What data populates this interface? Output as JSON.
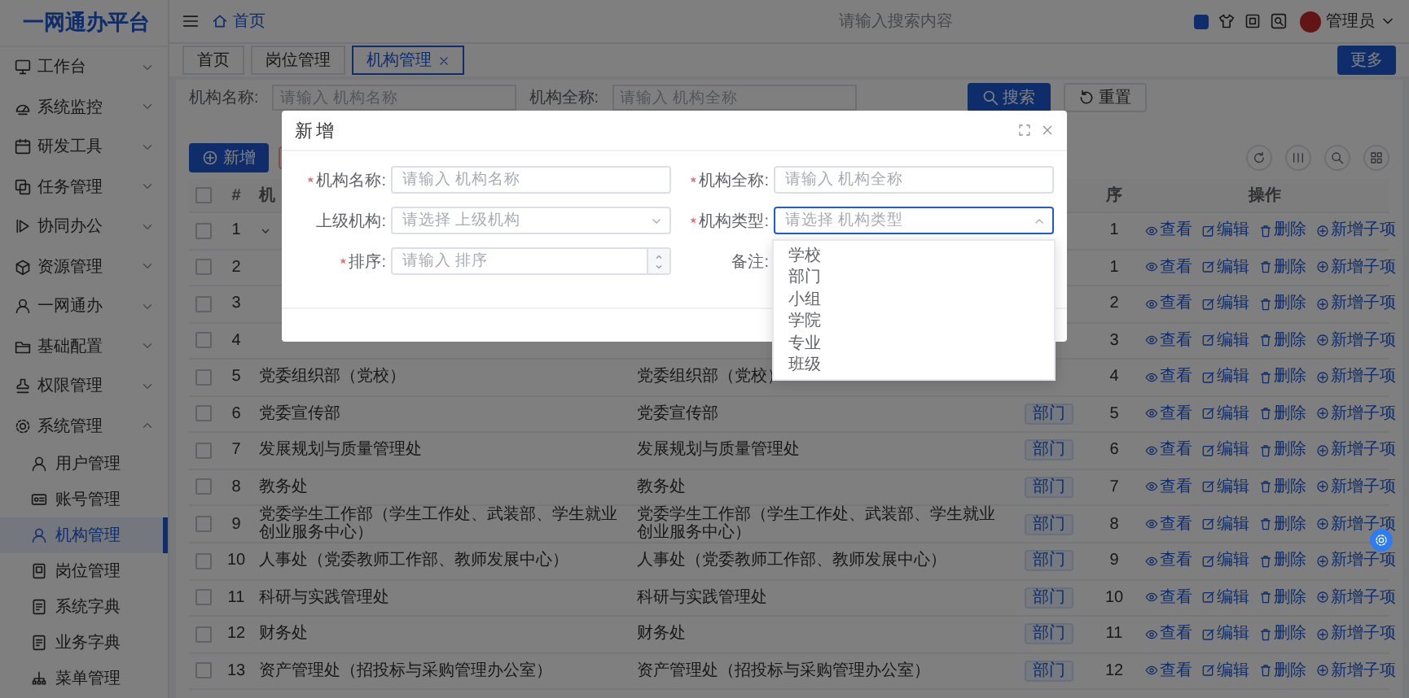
{
  "sidebar": {
    "logo": "一网通办平台",
    "items": [
      {
        "label": "工作台",
        "expanded": false
      },
      {
        "label": "系统监控",
        "expanded": false
      },
      {
        "label": "研发工具",
        "expanded": false
      },
      {
        "label": "任务管理",
        "expanded": false
      },
      {
        "label": "协同办公",
        "expanded": false
      },
      {
        "label": "资源管理",
        "expanded": false
      },
      {
        "label": "一网通办",
        "expanded": false
      },
      {
        "label": "基础配置",
        "expanded": false
      },
      {
        "label": "权限管理",
        "expanded": false
      },
      {
        "label": "系统管理",
        "expanded": true,
        "children": [
          {
            "label": "用户管理",
            "selected": false
          },
          {
            "label": "账号管理",
            "selected": false
          },
          {
            "label": "机构管理",
            "selected": true
          },
          {
            "label": "岗位管理",
            "selected": false
          },
          {
            "label": "系统字典",
            "selected": false
          },
          {
            "label": "业务字典",
            "selected": false
          },
          {
            "label": "菜单管理",
            "selected": false
          }
        ]
      }
    ]
  },
  "header": {
    "breadcrumb": "首页",
    "search": {
      "placeholder": "请输入搜索内容"
    },
    "user": "管理员"
  },
  "tabs": [
    {
      "label": "首页",
      "selected": false,
      "closable": false
    },
    {
      "label": "岗位管理",
      "selected": false,
      "closable": false
    },
    {
      "label": "机构管理",
      "selected": true,
      "closable": true
    }
  ],
  "more_button": "更多",
  "filters": [
    {
      "label": "机构名称:",
      "placeholder": "请输入 机构名称"
    },
    {
      "label": "机构全称:",
      "placeholder": "请输入 机构全称"
    }
  ],
  "filter_buttons": [
    {
      "kind": "search",
      "label": "搜索"
    },
    {
      "kind": "reset",
      "label": "重置"
    }
  ],
  "toolbar": {
    "add_button": "新增"
  },
  "table": {
    "all_checked": false,
    "columns": {
      "index": "#",
      "name": "机",
      "sort": "序",
      "actions": "操作"
    },
    "rows": [
      {
        "checked": false,
        "index": "1",
        "expandable": true,
        "sort": "1",
        "actions": [
          "查看",
          "编辑",
          "删除",
          "新增子项"
        ]
      },
      {
        "checked": false,
        "index": "2",
        "expandable": false,
        "sort": "1",
        "actions": [
          "查看",
          "编辑",
          "删除",
          "新增子项"
        ]
      },
      {
        "checked": false,
        "index": "3",
        "expandable": false,
        "sort": "2",
        "actions": [
          "查看",
          "编辑",
          "删除",
          "新增子项"
        ]
      },
      {
        "checked": false,
        "index": "4",
        "expandable": false,
        "sort": "3",
        "actions": [
          "查看",
          "编辑",
          "删除",
          "新增子项"
        ]
      },
      {
        "checked": false,
        "index": "5",
        "expandable": false,
        "name": "党委组织部（党校）",
        "full_name": "党委组织部（党校）",
        "sort": "4",
        "actions": [
          "查看",
          "编辑",
          "删除",
          "新增子项"
        ]
      },
      {
        "checked": false,
        "index": "6",
        "expandable": false,
        "name": "党委宣传部",
        "full_name": "党委宣传部",
        "type": "部门",
        "sort": "5",
        "actions": [
          "查看",
          "编辑",
          "删除",
          "新增子项"
        ]
      },
      {
        "checked": false,
        "index": "7",
        "expandable": false,
        "name": "发展规划与质量管理处",
        "full_name": "发展规划与质量管理处",
        "type": "部门",
        "sort": "6",
        "actions": [
          "查看",
          "编辑",
          "删除",
          "新增子项"
        ]
      },
      {
        "checked": false,
        "index": "8",
        "expandable": false,
        "name": "教务处",
        "full_name": "教务处",
        "type": "部门",
        "sort": "7",
        "actions": [
          "查看",
          "编辑",
          "删除",
          "新增子项"
        ]
      },
      {
        "checked": false,
        "index": "9",
        "expandable": false,
        "name": "党委学生工作部（学生工作处、武装部、学生就业创业服务中心）",
        "full_name": "党委学生工作部（学生工作处、武装部、学生就业创业服务中心）",
        "type": "部门",
        "sort": "8",
        "actions": [
          "查看",
          "编辑",
          "删除",
          "新增子项"
        ]
      },
      {
        "checked": false,
        "index": "10",
        "expandable": false,
        "name": "人事处（党委教师工作部、教师发展中心）",
        "full_name": "人事处（党委教师工作部、教师发展中心）",
        "type": "部门",
        "sort": "9",
        "actions": [
          "查看",
          "编辑",
          "删除",
          "新增子项"
        ]
      },
      {
        "checked": false,
        "index": "11",
        "expandable": false,
        "name": "科研与实践管理处",
        "full_name": "科研与实践管理处",
        "type": "部门",
        "sort": "10",
        "actions": [
          "查看",
          "编辑",
          "删除",
          "新增子项"
        ]
      },
      {
        "checked": false,
        "index": "12",
        "expandable": false,
        "name": "财务处",
        "full_name": "财务处",
        "type": "部门",
        "sort": "11",
        "actions": [
          "查看",
          "编辑",
          "删除",
          "新增子项"
        ]
      },
      {
        "checked": false,
        "index": "13",
        "expandable": false,
        "name": "资产管理处（招投标与采购管理办公室）",
        "full_name": "资产管理处（招投标与采购管理办公室）",
        "type": "部门",
        "sort": "12",
        "actions": [
          "查看",
          "编辑",
          "删除",
          "新增子项"
        ]
      }
    ]
  },
  "modal": {
    "title": "新增",
    "fields": [
      {
        "kind": "input",
        "label": "机构名称:",
        "required": true,
        "placeholder": "请输入 机构名称"
      },
      {
        "kind": "input",
        "label": "机构全称:",
        "required": true,
        "placeholder": "请输入 机构全称"
      },
      {
        "kind": "select",
        "label": "上级机构:",
        "required": false,
        "placeholder": "请选择 上级机构",
        "open": false
      },
      {
        "kind": "select",
        "label": "机构类型:",
        "required": true,
        "placeholder": "请选择 机构类型",
        "open": true,
        "options": [
          {
            "label": "学校"
          },
          {
            "label": "部门"
          },
          {
            "label": "小组"
          },
          {
            "label": "学院"
          },
          {
            "label": "专业"
          },
          {
            "label": "班级"
          }
        ]
      },
      {
        "kind": "number",
        "label": "排序:",
        "required": true,
        "placeholder": "请输入 排序"
      },
      {
        "label": "备注:",
        "required": false
      }
    ]
  }
}
